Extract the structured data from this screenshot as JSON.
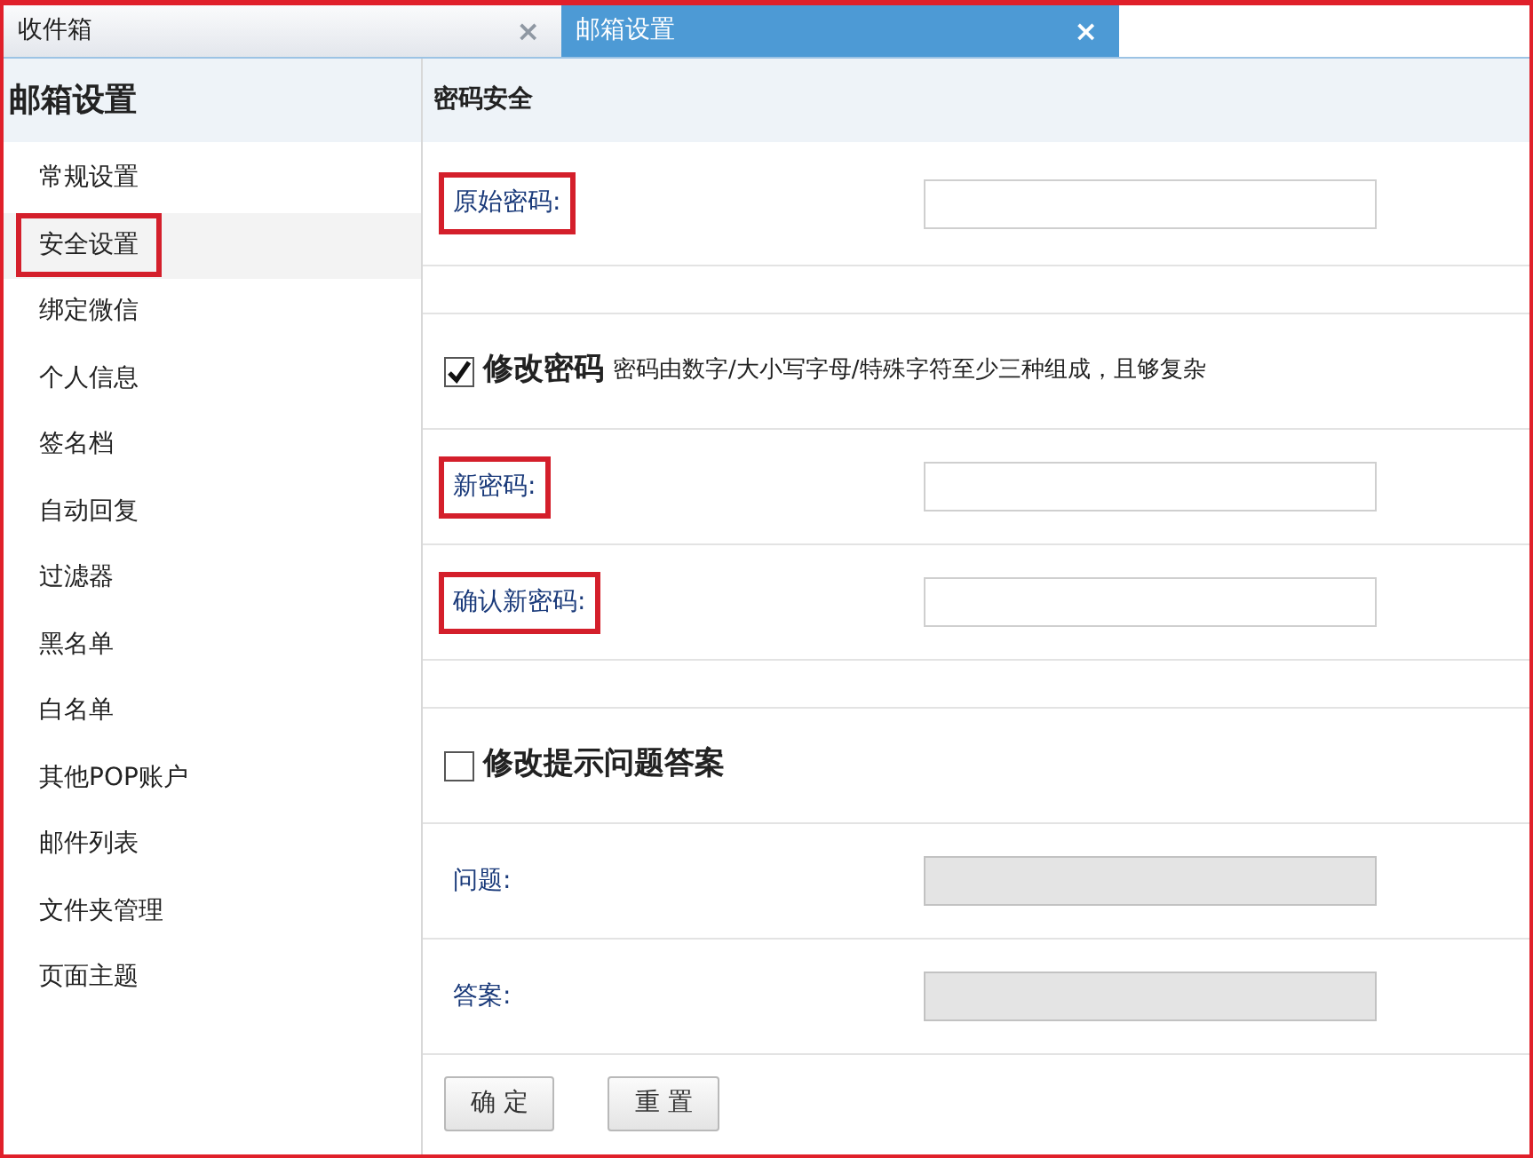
{
  "tabs": [
    {
      "label": "收件箱",
      "close": "×",
      "selected": false
    },
    {
      "label": "邮箱设置",
      "close": "×",
      "selected": true
    }
  ],
  "sidebar": {
    "title": "邮箱设置",
    "items": [
      {
        "label": "常规设置",
        "selected": false,
        "highlighted": false
      },
      {
        "label": "安全设置",
        "selected": true,
        "highlighted": true
      },
      {
        "label": "绑定微信",
        "selected": false,
        "highlighted": false
      },
      {
        "label": "个人信息",
        "selected": false,
        "highlighted": false
      },
      {
        "label": "签名档",
        "selected": false,
        "highlighted": false
      },
      {
        "label": "自动回复",
        "selected": false,
        "highlighted": false
      },
      {
        "label": "过滤器",
        "selected": false,
        "highlighted": false
      },
      {
        "label": "黑名单",
        "selected": false,
        "highlighted": false
      },
      {
        "label": "白名单",
        "selected": false,
        "highlighted": false
      },
      {
        "label": "其他POP账户",
        "selected": false,
        "highlighted": false
      },
      {
        "label": "邮件列表",
        "selected": false,
        "highlighted": false
      },
      {
        "label": "文件夹管理",
        "selected": false,
        "highlighted": false
      },
      {
        "label": "页面主题",
        "selected": false,
        "highlighted": false
      }
    ]
  },
  "section_title": "密码安全",
  "rows": [
    {
      "kind": "field",
      "label": "原始密码:",
      "highlighted": true,
      "disabled": false
    },
    {
      "kind": "spacer"
    },
    {
      "kind": "checkbox",
      "label": "修改密码",
      "hint": "密码由数字/大小写字母/特殊字符至少三种组成，且够复杂",
      "checked": true
    },
    {
      "kind": "field",
      "label": "新密码:",
      "highlighted": true,
      "disabled": false
    },
    {
      "kind": "field",
      "label": "确认新密码:",
      "highlighted": true,
      "disabled": false
    },
    {
      "kind": "spacer"
    },
    {
      "kind": "checkbox",
      "label": "修改提示问题答案",
      "checked": false
    },
    {
      "kind": "field",
      "label": "问题:",
      "highlighted": false,
      "disabled": true
    },
    {
      "kind": "field",
      "label": "答案:",
      "highlighted": false,
      "disabled": true
    }
  ],
  "buttons": [
    "确 定",
    "重 置"
  ]
}
